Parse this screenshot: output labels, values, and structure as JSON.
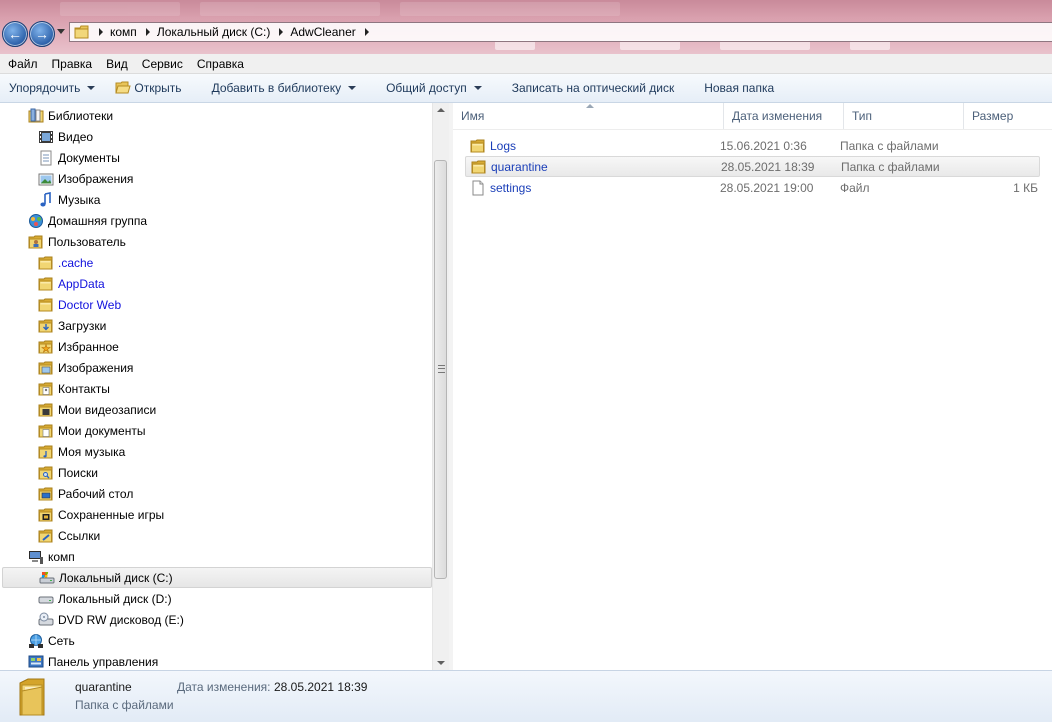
{
  "address": {
    "crumbs": [
      "комп",
      "Локальный диск (C:)",
      "AdwCleaner"
    ]
  },
  "menu": [
    "Файл",
    "Правка",
    "Вид",
    "Сервис",
    "Справка"
  ],
  "toolbar": {
    "organize": "Упорядочить",
    "open": "Открыть",
    "add_to_library": "Добавить в библиотеку",
    "share": "Общий доступ",
    "burn": "Записать на оптический диск",
    "new_folder": "Новая папка"
  },
  "nav": [
    {
      "label": "Библиотеки",
      "icon": "libraries-icon",
      "indent": 0
    },
    {
      "label": "Видео",
      "icon": "video-library-icon",
      "indent": 1
    },
    {
      "label": "Документы",
      "icon": "documents-library-icon",
      "indent": 1
    },
    {
      "label": "Изображения",
      "icon": "pictures-library-icon",
      "indent": 1
    },
    {
      "label": "Музыка",
      "icon": "music-library-icon",
      "indent": 1
    },
    {
      "label": "Домашняя группа",
      "icon": "homegroup-icon",
      "indent": 0
    },
    {
      "label": "Пользователь",
      "icon": "user-folder-icon",
      "indent": 0
    },
    {
      "label": ".cache",
      "icon": "folder-icon",
      "indent": 1,
      "blue": true
    },
    {
      "label": "AppData",
      "icon": "folder-icon",
      "indent": 1,
      "blue": true
    },
    {
      "label": "Doctor Web",
      "icon": "folder-icon",
      "indent": 1,
      "blue": true
    },
    {
      "label": "Загрузки",
      "icon": "downloads-folder-icon",
      "indent": 1
    },
    {
      "label": "Избранное",
      "icon": "favorites-folder-icon",
      "indent": 1
    },
    {
      "label": "Изображения",
      "icon": "pictures-folder-icon",
      "indent": 1
    },
    {
      "label": "Контакты",
      "icon": "contacts-folder-icon",
      "indent": 1
    },
    {
      "label": "Мои видеозаписи",
      "icon": "videos-folder-icon",
      "indent": 1
    },
    {
      "label": "Мои документы",
      "icon": "documents-folder-icon",
      "indent": 1
    },
    {
      "label": "Моя музыка",
      "icon": "music-folder-icon",
      "indent": 1
    },
    {
      "label": "Поиски",
      "icon": "searches-folder-icon",
      "indent": 1
    },
    {
      "label": "Рабочий стол",
      "icon": "desktop-folder-icon",
      "indent": 1
    },
    {
      "label": "Сохраненные игры",
      "icon": "saved-games-folder-icon",
      "indent": 1
    },
    {
      "label": "Ссылки",
      "icon": "links-folder-icon",
      "indent": 1
    },
    {
      "label": "комп",
      "icon": "computer-icon",
      "indent": 0
    },
    {
      "label": "Локальный диск (C:)",
      "icon": "system-drive-icon",
      "indent": 1,
      "selected": true
    },
    {
      "label": "Локальный диск (D:)",
      "icon": "drive-icon",
      "indent": 1
    },
    {
      "label": "DVD RW дисковод (E:)",
      "icon": "dvd-drive-icon",
      "indent": 1
    },
    {
      "label": "Сеть",
      "icon": "network-icon",
      "indent": 0
    },
    {
      "label": "Панель управления",
      "icon": "control-panel-icon",
      "indent": 0
    }
  ],
  "columns": {
    "name": "Имя",
    "date": "Дата изменения",
    "type": "Тип",
    "size": "Размер"
  },
  "files": [
    {
      "name": "Logs",
      "date": "15.06.2021 0:36",
      "type": "Папка с файлами",
      "size": "",
      "icon": "folder-icon"
    },
    {
      "name": "quarantine",
      "date": "28.05.2021 18:39",
      "type": "Папка с файлами",
      "size": "",
      "icon": "folder-icon",
      "selected": true
    },
    {
      "name": "settings",
      "date": "28.05.2021 19:00",
      "type": "Файл",
      "size": "1 КБ",
      "icon": "file-icon"
    }
  ],
  "details": {
    "name": "quarantine",
    "subtitle": "Папка с файлами",
    "date_label": "Дата изменения:",
    "date_value": "28.05.2021 18:39"
  },
  "colors": {
    "link_blue": "#1111dd",
    "file_name": "#1a3eb8",
    "toolbar_text": "#1e395b",
    "folder_yellow": "#e8c45a"
  }
}
